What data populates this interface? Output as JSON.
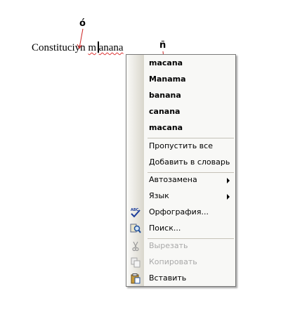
{
  "document": {
    "text_before": "Constituciyn ",
    "text_misspelled_start": "m",
    "text_misspelled_end": "anana",
    "annotation_top": "ó",
    "annotation_right": "ñ"
  },
  "context_menu": {
    "suggestions": [
      "macana",
      "Manama",
      "banana",
      "canana",
      "macana"
    ],
    "ignore_all": "Пропустить все",
    "add_to_dictionary": "Добавить в словарь",
    "autocorrect": "Автозамена",
    "language": "Язык",
    "spelling": "Орфография...",
    "search": "Поиск...",
    "cut": "Вырезать",
    "copy": "Копировать",
    "paste": "Вставить",
    "icons": {
      "spelling": "spelling-check-icon",
      "search": "search-icon",
      "cut": "scissors-icon",
      "copy": "copy-icon",
      "paste": "paste-icon"
    }
  }
}
